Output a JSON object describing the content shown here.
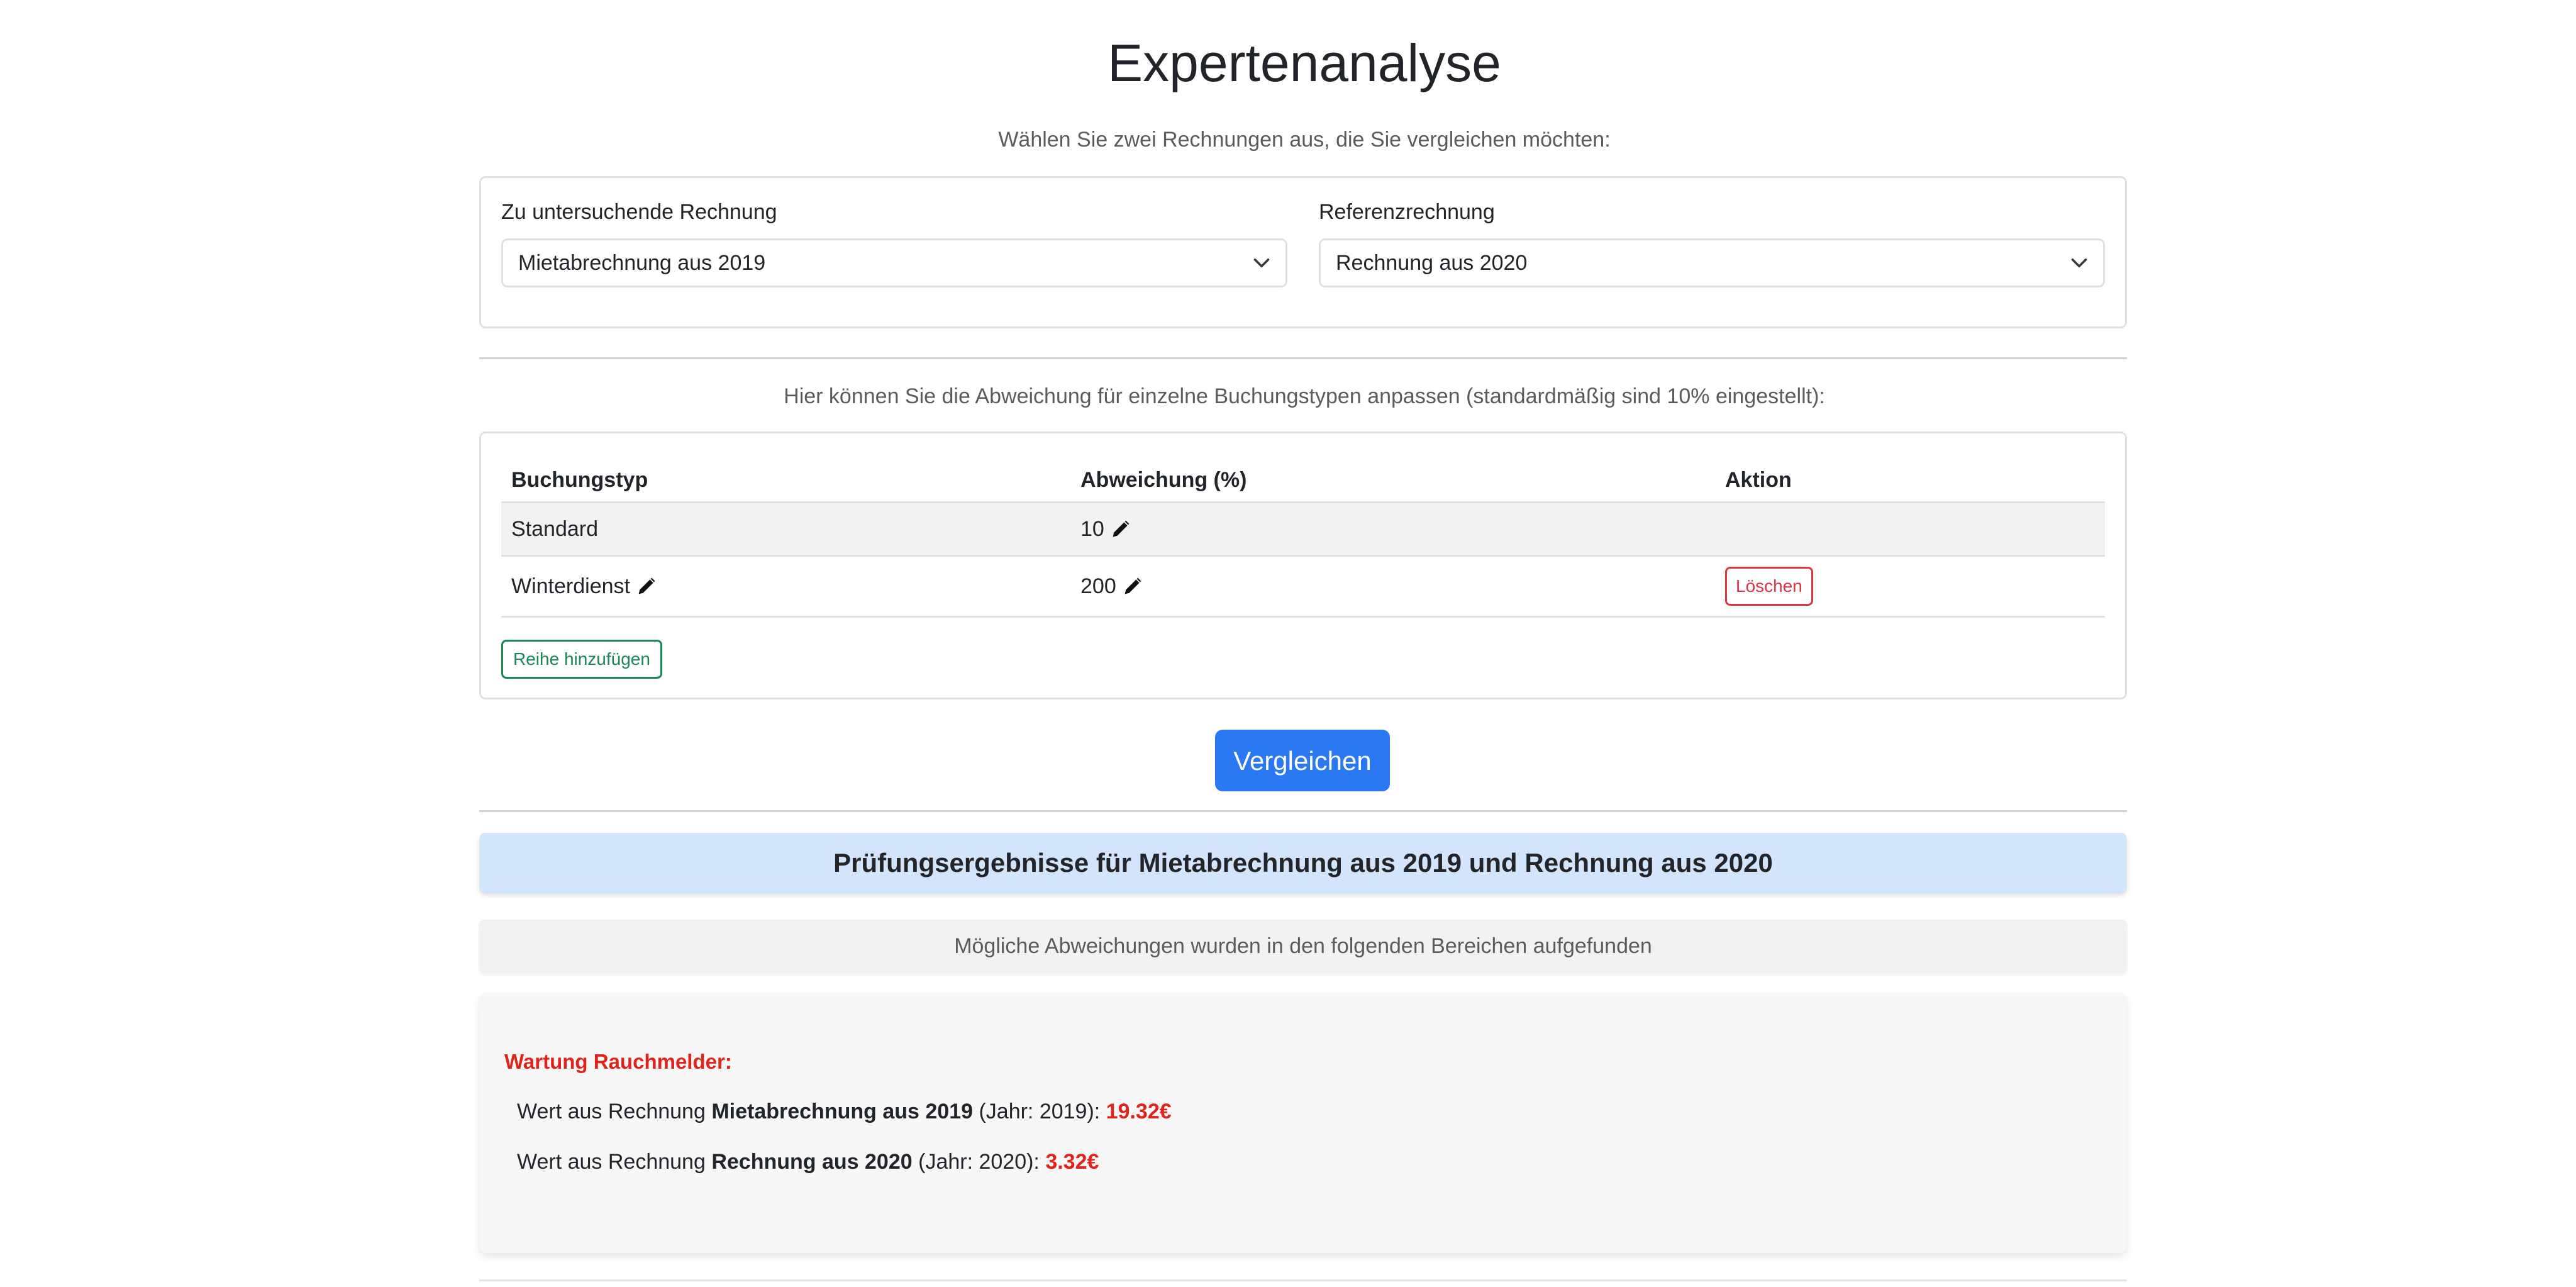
{
  "page": {
    "title": "Expertenanalyse",
    "subtitle": "Wählen Sie zwei Rechnungen aus, die Sie vergleichen möchten:"
  },
  "selection": {
    "invoice_label": "Zu untersuchende Rechnung",
    "invoice_value": "Mietabrechnung aus 2019",
    "reference_label": "Referenzrechnung",
    "reference_value": "Rechnung aus 2020"
  },
  "deviation": {
    "hint": "Hier können Sie die Abweichung für einzelne Buchungstypen anpassen (standardmäßig sind 10% eingestellt):",
    "columns": [
      "Buchungstyp",
      "Abweichung (%)",
      "Aktion"
    ],
    "rows": [
      {
        "type": "Standard",
        "percent": "10",
        "action": ""
      },
      {
        "type": "Winterdienst",
        "percent": "200",
        "action": "Löschen"
      }
    ],
    "add_row_label": "Reihe hinzufügen"
  },
  "compare_label": "Vergleichen",
  "results": {
    "header": "Prüfungsergebnisse für Mietabrechnung aus 2019 und Rechnung aus 2020",
    "subheader": "Mögliche Abweichungen wurden in den folgenden Bereichen aufgefunden",
    "findings": [
      {
        "title": "Wartung Rauchmelder:",
        "lines": [
          {
            "prefix": "Wert aus Rechnung ",
            "invoice": "Mietabrechnung aus 2019",
            "year": " (Jahr: 2019): ",
            "value": "19.32€"
          },
          {
            "prefix": "Wert aus Rechnung ",
            "invoice": "Rechnung aus 2020",
            "year": " (Jahr: 2020): ",
            "value": "3.32€"
          }
        ]
      }
    ]
  },
  "colors": {
    "primary": "#2a78f2",
    "danger": "#dc3545",
    "success": "#198754",
    "highlight": "#e0231b",
    "result_header_bg": "#d3e5fb"
  }
}
